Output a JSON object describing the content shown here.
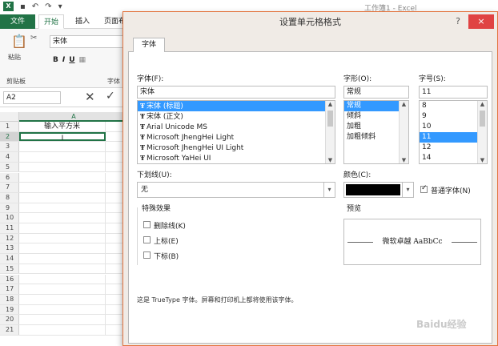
{
  "excel": {
    "window_title": "工作簿1 - Excel",
    "ribbon_tabs": [
      "文件",
      "开始",
      "插入",
      "页面布"
    ],
    "active_tab": "开始",
    "clipboard_paste": "粘贴",
    "clipboard_group": "剪贴板",
    "font_group_label": "字体",
    "font_name": "宋体",
    "name_box": "A2",
    "column_header": "A",
    "rows": [
      "1",
      "2",
      "3",
      "4",
      "5",
      "6",
      "7",
      "8",
      "9",
      "10",
      "11",
      "12",
      "13",
      "14",
      "15",
      "16",
      "17",
      "18",
      "19",
      "20",
      "21"
    ],
    "cell_a1": "输入平方米",
    "cell_a2": "I"
  },
  "dialog": {
    "title": "设置单元格格式",
    "help": "?",
    "close": "×",
    "tab": "字体",
    "font_label": "字体(F):",
    "font_value": "宋体",
    "font_list": [
      "宋体 (标题)",
      "宋体 (正文)",
      "Arial Unicode MS",
      "Microsoft JhengHei Light",
      "Microsoft JhengHei UI Light",
      "Microsoft YaHei UI"
    ],
    "style_label": "字形(O):",
    "style_value": "常规",
    "style_list": [
      "常规",
      "倾斜",
      "加粗",
      "加粗倾斜"
    ],
    "size_label": "字号(S):",
    "size_value": "11",
    "size_list": [
      "8",
      "9",
      "10",
      "11",
      "12",
      "14"
    ],
    "underline_label": "下划线(U):",
    "underline_value": "无",
    "color_label": "颜色(C):",
    "normal_font_label": "普通字体(N)",
    "effects_label": "特殊效果",
    "strike_label": "删除线(K)",
    "super_label": "上标(E)",
    "sub_label": "下标(B)",
    "preview_label": "预览",
    "preview_text": "微软卓越  AaBbCc",
    "note": "这是 TrueType 字体。屏幕和打印机上都将使用该字体。"
  },
  "colors": {
    "excel_green": "#217346",
    "selection_blue": "#3399ff",
    "close_red": "#e04343",
    "dialog_border": "#e3743f"
  },
  "watermark": "Baidu经验"
}
